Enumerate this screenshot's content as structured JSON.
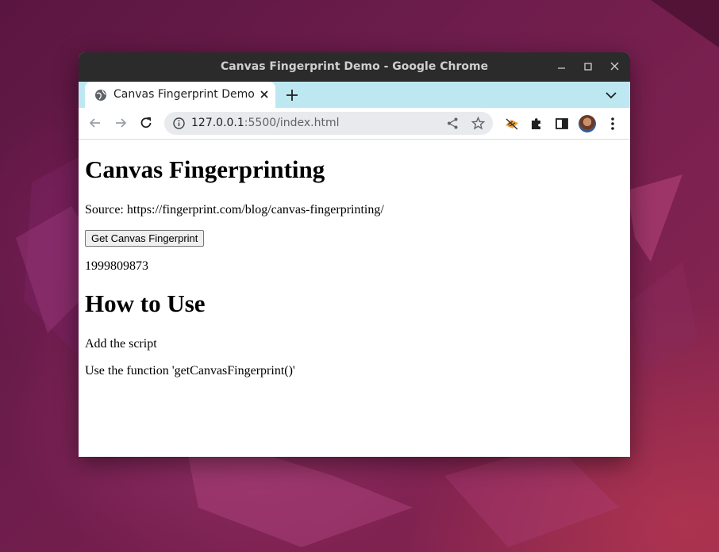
{
  "window": {
    "title": "Canvas Fingerprint Demo - Google Chrome"
  },
  "tabs": [
    {
      "label": "Canvas Fingerprint Demo"
    }
  ],
  "omnibox": {
    "url_host": "127.0.0.1",
    "url_rest": ":5500/index.html"
  },
  "icons": {
    "favicon": "globe-icon",
    "tab_close": "close-icon",
    "new_tab": "plus-icon",
    "tab_list": "chevron-down-icon",
    "back": "back-arrow-icon",
    "forward": "forward-arrow-icon",
    "reload": "reload-icon",
    "site_info": "info-icon",
    "share": "share-icon",
    "bookmark": "star-icon",
    "extension": "extension-icon",
    "puzzle": "puzzle-icon",
    "side_panel": "side-panel-icon",
    "menu": "kebab-menu-icon"
  },
  "page": {
    "heading": "Canvas Fingerprinting",
    "source": "Source: https://fingerprint.com/blog/canvas-fingerprinting/",
    "button_label": "Get Canvas Fingerprint",
    "result": "1999809873",
    "howto_heading": "How to Use",
    "step1": "Add the script",
    "step2": "Use the function 'getCanvasFingerprint()'"
  },
  "colors": {
    "titlebar": "#2b2b2b",
    "tabstrip": "#bde8f1",
    "omnibox": "#e9eaed",
    "wallpaper": "#6e1d4c"
  }
}
